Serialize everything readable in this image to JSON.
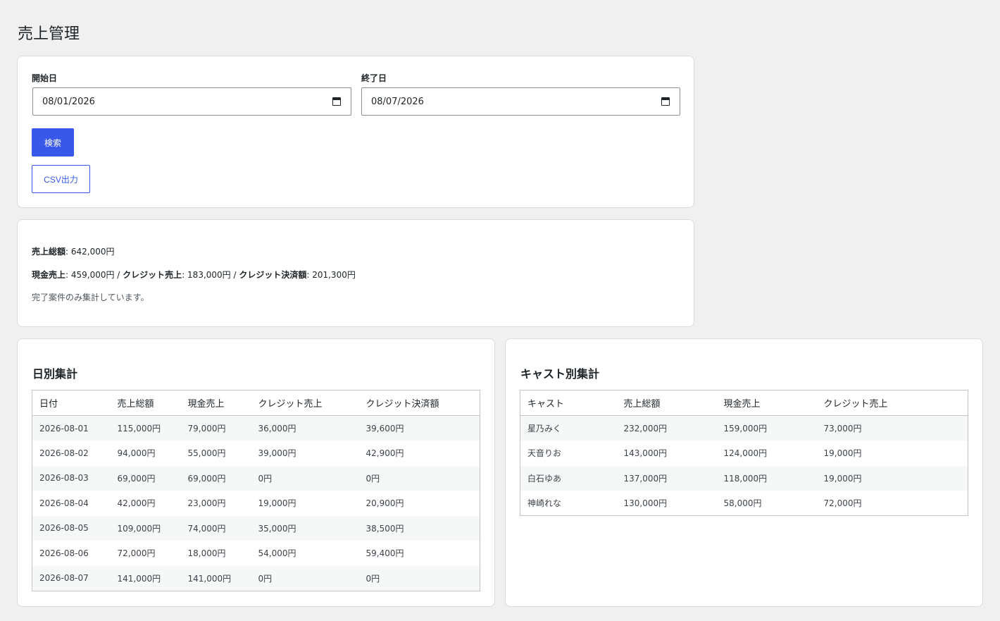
{
  "page": {
    "title": "売上管理"
  },
  "filter": {
    "start_label": "開始日",
    "start_value": "08/01/2026",
    "end_label": "終了日",
    "end_value": "08/07/2026",
    "search_label": "検索",
    "csv_label": "CSV出力"
  },
  "summary": {
    "total_label": "売上総額",
    "total_value": ": 642,000円",
    "cash_label": "現金売上",
    "cash_value": ": 459,000円 / ",
    "credit_label": "クレジット売上",
    "credit_value": ": 183,000円 / ",
    "settle_label": "クレジット決済額",
    "settle_value": ": 201,300円",
    "note": "完了案件のみ集計しています。"
  },
  "daily": {
    "title": "日別集計",
    "headers": [
      "日付",
      "売上総額",
      "現金売上",
      "クレジット売上",
      "クレジット決済額"
    ],
    "rows": [
      [
        "2026-08-01",
        "115,000円",
        "79,000円",
        "36,000円",
        "39,600円"
      ],
      [
        "2026-08-02",
        "94,000円",
        "55,000円",
        "39,000円",
        "42,900円"
      ],
      [
        "2026-08-03",
        "69,000円",
        "69,000円",
        "0円",
        "0円"
      ],
      [
        "2026-08-04",
        "42,000円",
        "23,000円",
        "19,000円",
        "20,900円"
      ],
      [
        "2026-08-05",
        "109,000円",
        "74,000円",
        "35,000円",
        "38,500円"
      ],
      [
        "2026-08-06",
        "72,000円",
        "18,000円",
        "54,000円",
        "59,400円"
      ],
      [
        "2026-08-07",
        "141,000円",
        "141,000円",
        "0円",
        "0円"
      ]
    ]
  },
  "cast": {
    "title": "キャスト別集計",
    "headers": [
      "キャスト",
      "売上総額",
      "現金売上",
      "クレジット売上"
    ],
    "rows": [
      [
        "星乃みく",
        "232,000円",
        "159,000円",
        "73,000円"
      ],
      [
        "天音りお",
        "143,000円",
        "124,000円",
        "19,000円"
      ],
      [
        "白石ゆあ",
        "137,000円",
        "118,000円",
        "19,000円"
      ],
      [
        "神崎れな",
        "130,000円",
        "58,000円",
        "72,000円"
      ]
    ]
  }
}
